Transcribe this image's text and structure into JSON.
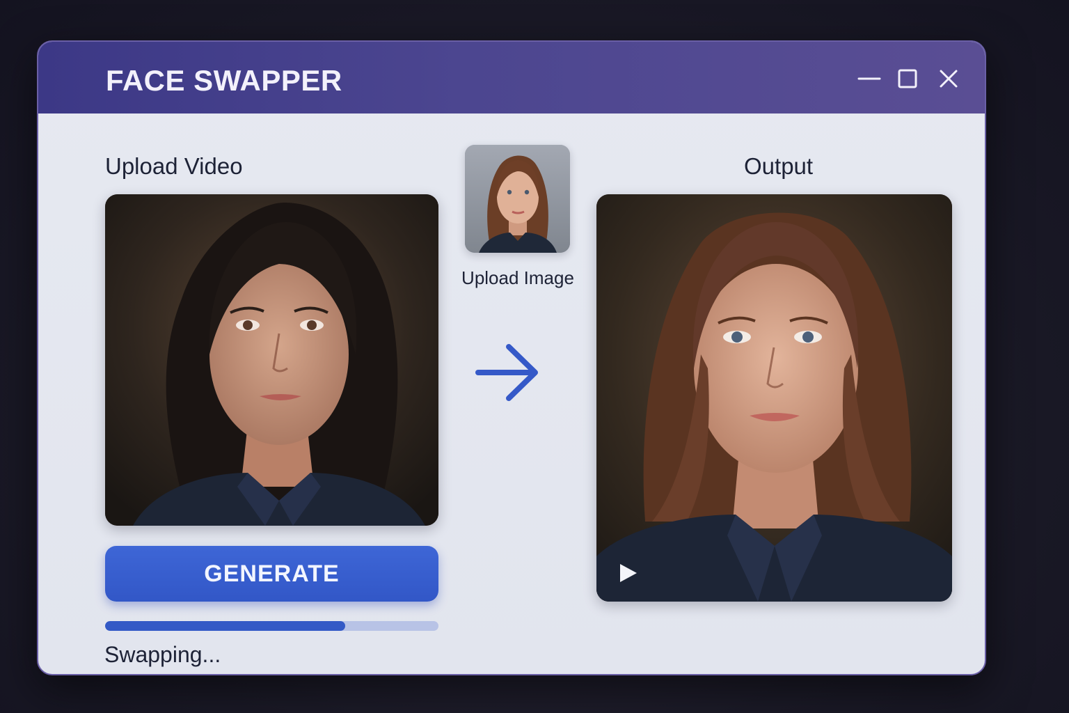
{
  "window": {
    "title": "FACE SWAPPER",
    "controls": [
      "minimize-icon",
      "maximize-icon",
      "close-icon"
    ]
  },
  "left": {
    "label": "Upload Video",
    "generate_label": "GENERATE",
    "progress": 0.72,
    "status": "Swapping..."
  },
  "middle": {
    "upload_image_label": "Upload Image",
    "arrow_icon": "arrow-right-icon"
  },
  "right": {
    "label": "Output",
    "play_icon": "play-icon"
  },
  "colors": {
    "titlebar": "#46408b",
    "accent": "#3a60d0",
    "progress_track": "#b8c3e6",
    "window_bg": "#e4e7ef"
  }
}
